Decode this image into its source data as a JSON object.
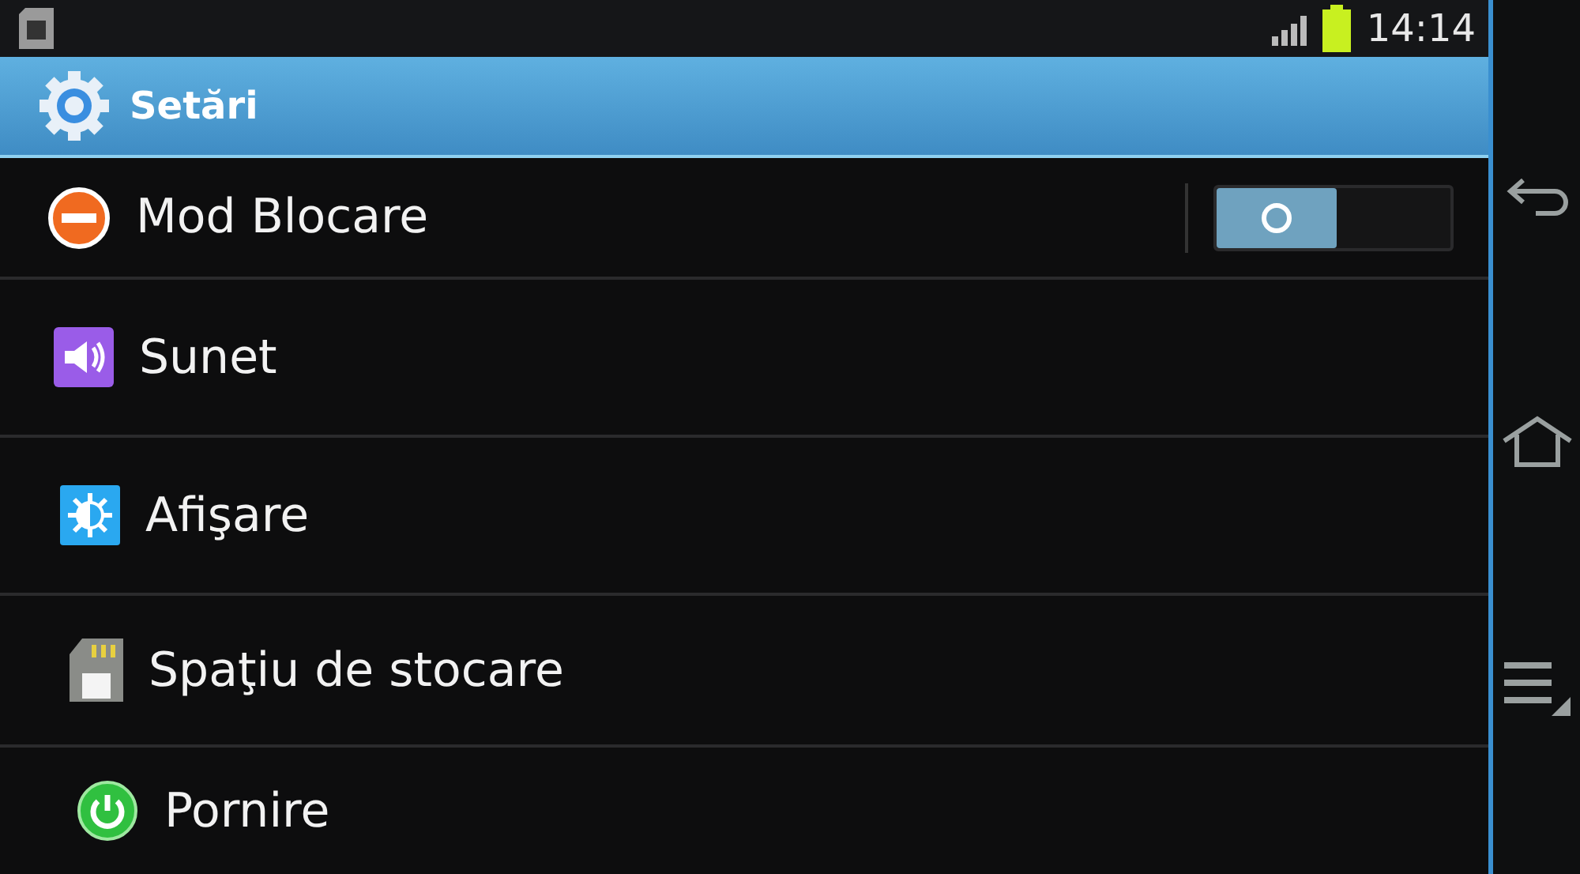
{
  "status_bar": {
    "time": "14:14"
  },
  "action_bar": {
    "title": "Setări"
  },
  "settings": [
    {
      "label": "Mod Blocare",
      "kind": "switch",
      "on": false
    },
    {
      "label": "Sunet",
      "kind": "link"
    },
    {
      "label": "Afişare",
      "kind": "link"
    },
    {
      "label": "Spaţiu de stocare",
      "kind": "link"
    },
    {
      "label": "Pornire",
      "kind": "link"
    }
  ]
}
